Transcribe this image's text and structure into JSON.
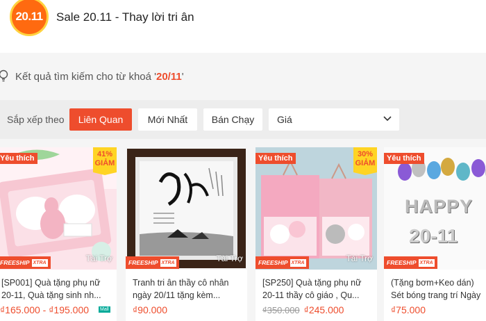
{
  "header": {
    "logo_text": "20.11",
    "title": "Sale 20.11 - Thay lời tri ân"
  },
  "search": {
    "prefix": "Kết quả tìm kiếm cho từ khoá '",
    "keyword": "20/11",
    "suffix": "'"
  },
  "sort": {
    "label": "Sắp xếp theo",
    "options": [
      "Liên Quan",
      "Mới Nhất",
      "Bán Chạy"
    ],
    "active": "Liên Quan",
    "price_label": "Giá"
  },
  "products": [
    {
      "badge": "Yêu thích",
      "discount_pct": "41%",
      "discount_word": "GIẢM",
      "freeship": "FREESHIP",
      "freeship_extra": "XTRA",
      "sponsored": "Tài Trợ",
      "name": "[SP001] Quà tặng phụ nữ 20-11, Quà tặng sinh nh...",
      "price": "₫165.000 - ₫195.000",
      "tag": "Mall"
    },
    {
      "freeship": "FREESHIP",
      "freeship_extra": "XTRA",
      "sponsored": "Tài Trợ",
      "name": "Tranh tri ân thầy cô nhân ngày 20/11 tặng kèm...",
      "price": "₫90.000"
    },
    {
      "badge": "Yêu thích",
      "discount_pct": "30%",
      "discount_word": "GIẢM",
      "freeship": "FREESHIP",
      "freeship_extra": "XTRA",
      "sponsored": "Tài Trợ",
      "name": "[SP250] Quà tặng phụ nữ 20-11 thầy cô giáo , Qu...",
      "price_old": "₫350.000",
      "price": "₫245.000"
    },
    {
      "badge": "Yêu thích",
      "freeship": "FREESHIP",
      "freeship_extra": "XTRA",
      "image_text_1": "HAPPY",
      "image_text_2": "20-11",
      "name": "(Tặng bơm+Keo dán) Sét bóng trang trí Ngày nhà...",
      "price": "₫75.000"
    }
  ]
}
